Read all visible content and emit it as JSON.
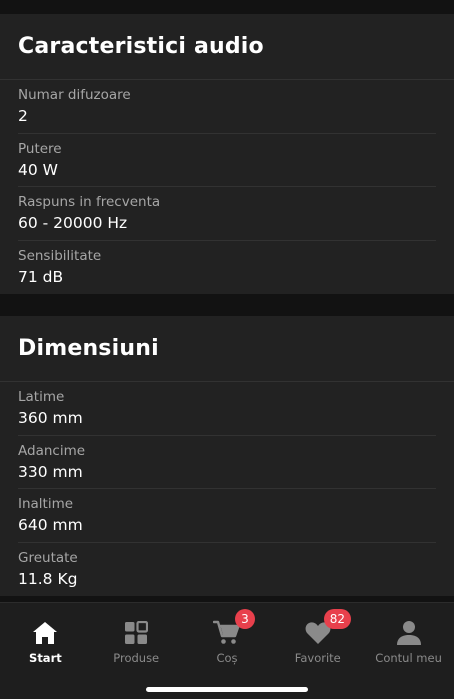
{
  "audio": {
    "title": "Caracteristici audio",
    "specs": [
      {
        "label": "Numar difuzoare",
        "value": "2"
      },
      {
        "label": "Putere",
        "value": "40 W"
      },
      {
        "label": "Raspuns in frecventa",
        "value": "60 - 20000 Hz"
      },
      {
        "label": "Sensibilitate",
        "value": "71 dB"
      }
    ]
  },
  "dimensions": {
    "title": "Dimensiuni",
    "specs": [
      {
        "label": "Latime",
        "value": "360 mm"
      },
      {
        "label": "Adancime",
        "value": "330 mm"
      },
      {
        "label": "Inaltime",
        "value": "640 mm"
      },
      {
        "label": "Greutate",
        "value": "11.8 Kg"
      }
    ]
  },
  "nav": {
    "items": [
      {
        "label": "Start",
        "icon": "home-icon",
        "active": true
      },
      {
        "label": "Produse",
        "icon": "grid-icon"
      },
      {
        "label": "Coș",
        "icon": "cart-icon",
        "badge": "3"
      },
      {
        "label": "Favorite",
        "icon": "heart-icon",
        "badge": "82"
      },
      {
        "label": "Contul meu",
        "icon": "user-icon"
      }
    ]
  },
  "colors": {
    "background": "#121212",
    "card": "#222222",
    "badge": "#e8404c"
  }
}
